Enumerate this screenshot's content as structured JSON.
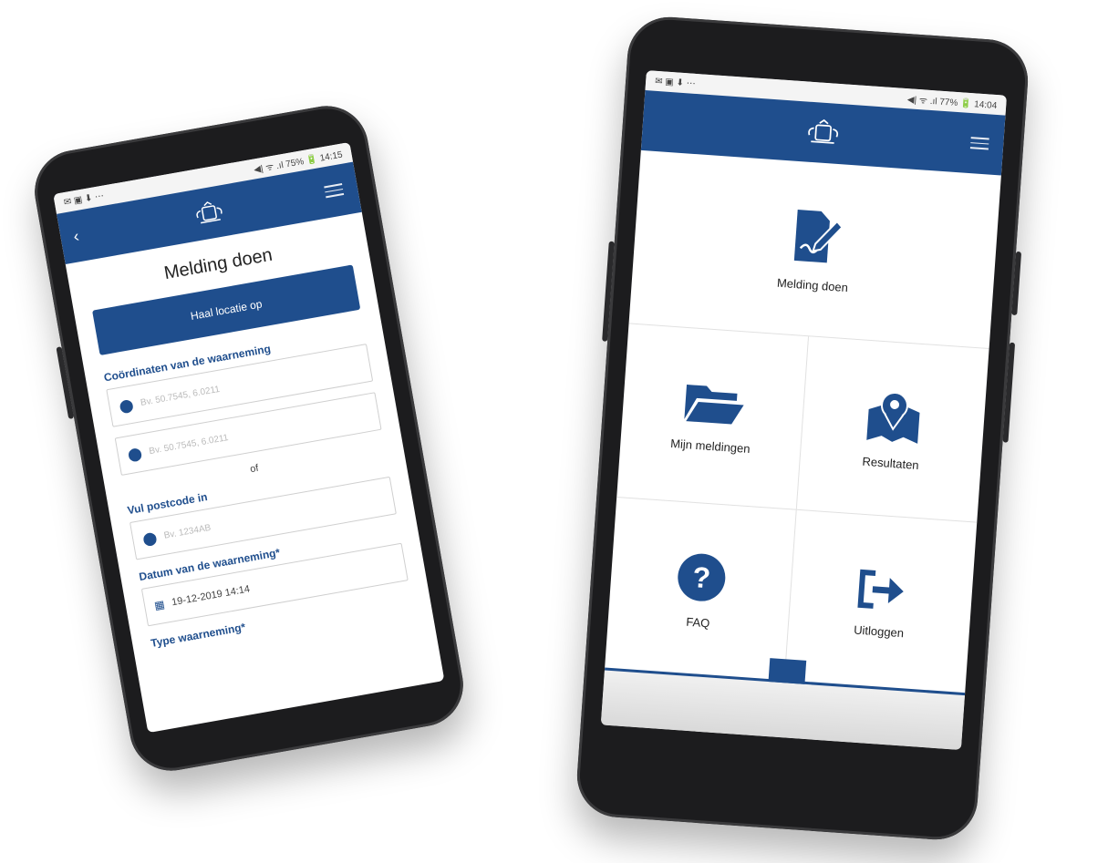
{
  "colors": {
    "primary": "#1f4e8d",
    "label": "#1f4e8d",
    "frame": "#1c1c1e"
  },
  "left_phone": {
    "status": {
      "left": "✉ ▣ ⬇ ⋯",
      "right": "◀| ᯤ .ıl 75% 🔋 14:15"
    },
    "page_title": "Melding doen",
    "locate_button": "Haal locatie op",
    "coords_label": "Coördinaten van de waarneming",
    "coord_placeholder_1": "Bv. 50.7545, 6.0211",
    "coord_placeholder_2": "Bv. 50.7545, 6.0211",
    "or_text": "of",
    "postcode_label": "Vul postcode in",
    "postcode_placeholder": "Bv. 1234AB",
    "date_label": "Datum van de waarneming*",
    "date_value": "19-12-2019 14:14",
    "type_label": "Type waarneming*"
  },
  "right_phone": {
    "status": {
      "left": "✉ ▣ ⬇ ⋯",
      "right": "◀| ᯤ .ıl 77% 🔋 14:04"
    },
    "tiles": [
      {
        "label": "Melding doen",
        "icon": "edit-document-icon"
      },
      {
        "label": "Mijn meldingen",
        "icon": "folder-icon"
      },
      {
        "label": "Resultaten",
        "icon": "map-pin-icon"
      },
      {
        "label": "FAQ",
        "icon": "question-icon"
      },
      {
        "label": "Uitloggen",
        "icon": "logout-icon"
      }
    ]
  }
}
